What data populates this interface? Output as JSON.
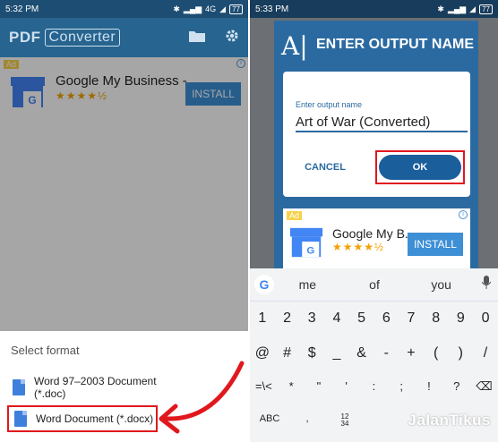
{
  "left": {
    "status": {
      "time": "5:32 PM",
      "network": "4G",
      "battery": "77"
    },
    "appbar": {
      "title_part1": "PDF",
      "title_part2": "Converter"
    },
    "ad": {
      "tag": "Ad",
      "title": "Google My Business -...",
      "stars": "★★★★½",
      "install": "INSTALL"
    },
    "sheet": {
      "title": "Select format",
      "options": [
        {
          "label": "Word 97–2003 Document (*.doc)"
        },
        {
          "label": "Word Document (*.docx)"
        }
      ]
    }
  },
  "right": {
    "status": {
      "time": "5:33 PM",
      "battery": "77"
    },
    "dialog": {
      "logo": "A|",
      "title": "ENTER OUTPUT NAME",
      "field_label": "Enter output name",
      "field_value": "Art of War (Converted)",
      "cancel": "CANCEL",
      "ok": "OK"
    },
    "ad": {
      "tag": "Ad",
      "title": "Google My B..",
      "stars": "★★★★½",
      "install": "INSTALL"
    },
    "keyboard": {
      "suggestions": [
        "me",
        "of",
        "you"
      ],
      "row1": [
        "1",
        "2",
        "3",
        "4",
        "5",
        "6",
        "7",
        "8",
        "9",
        "0"
      ],
      "row2": [
        "@",
        "#",
        "$",
        "_",
        "&",
        "-",
        "+",
        "(",
        ")",
        "/"
      ],
      "row3": [
        "=\\<",
        "*",
        "\"",
        "'",
        ":",
        ";",
        "!",
        "?",
        "⌫"
      ],
      "row4": [
        "ABC",
        ",",
        "12\n34"
      ]
    },
    "watermark": "JalanTikus"
  },
  "colors": {
    "highlight": "#e0181e",
    "primary": "#2b6aa1",
    "appbar": "#27648f"
  }
}
